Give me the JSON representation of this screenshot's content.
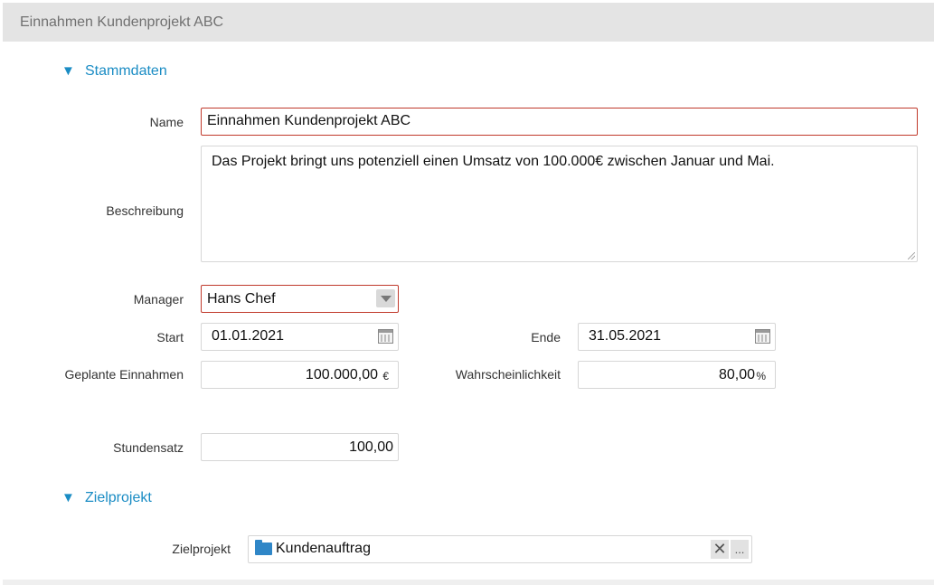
{
  "header": {
    "title": "Einnahmen Kundenprojekt ABC"
  },
  "sections": {
    "stammdaten": {
      "label": "Stammdaten",
      "icon": "triangle-down-icon"
    },
    "zielprojekt": {
      "label": "Zielprojekt",
      "icon": "triangle-down-icon"
    }
  },
  "form": {
    "name": {
      "label": "Name",
      "value": "Einnahmen Kundenprojekt ABC"
    },
    "beschreibung": {
      "label": "Beschreibung",
      "value": "Das Projekt bringt uns potenziell einen Umsatz von 100.000€ zwischen Januar und Mai."
    },
    "manager": {
      "label": "Manager",
      "value": "Hans Chef"
    },
    "start": {
      "label": "Start",
      "value": "01.01.2021"
    },
    "ende": {
      "label": "Ende",
      "value": "31.05.2021"
    },
    "geplante_einnahmen": {
      "label": "Geplante Einnahmen",
      "value": "100.000,00",
      "unit": "€"
    },
    "wahrscheinlichkeit": {
      "label": "Wahrscheinlichkeit",
      "value": "80,00",
      "unit": "%"
    },
    "stundensatz": {
      "label": "Stundensatz",
      "value": "100,00"
    },
    "zielprojekt": {
      "label": "Zielprojekt",
      "value": "Kundenauftrag",
      "clear_symbol": "✕",
      "more_symbol": "..."
    }
  },
  "colors": {
    "accent": "#1a8cc4",
    "required_border": "#c0392b",
    "header_bg": "#e4e4e4"
  }
}
